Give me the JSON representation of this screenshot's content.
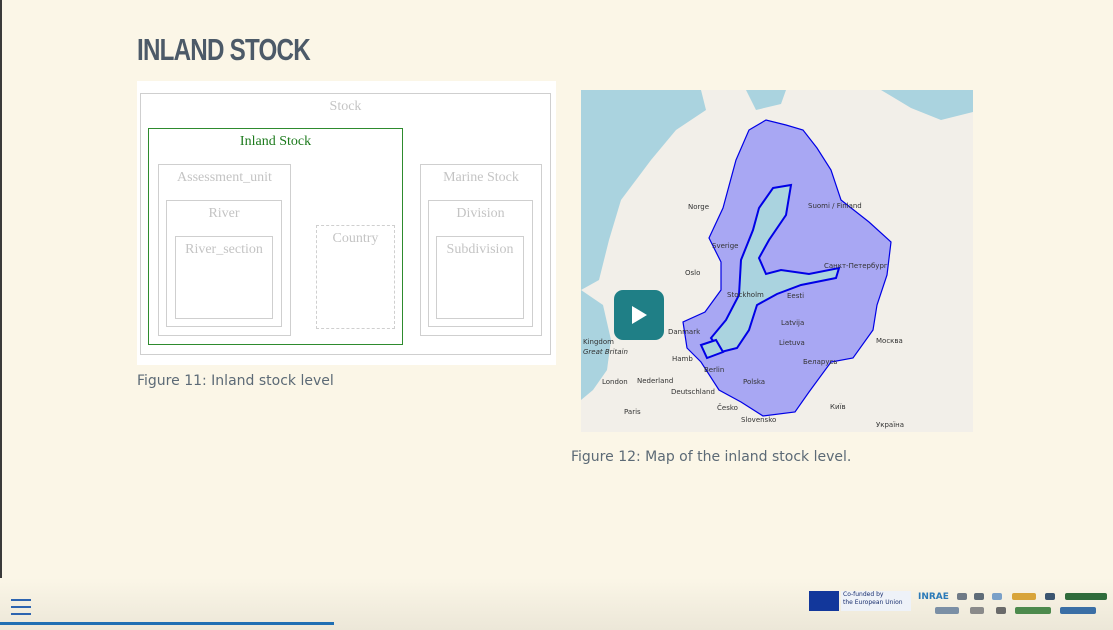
{
  "slide": {
    "title": "INLAND STOCK",
    "figure11_caption": "Figure 11: Inland stock level",
    "figure12_caption": "Figure 12: Map of the inland stock level."
  },
  "diagram": {
    "stock": "Stock",
    "inland_stock": "Inland Stock",
    "assessment_unit": "Assessment_unit",
    "river": "River",
    "river_section": "River_section",
    "country": "Country",
    "marine_stock": "Marine Stock",
    "division": "Division",
    "subdivision": "Subdivision"
  },
  "map": {
    "labels": {
      "finland": "Suomi / Finland",
      "norge": "Norge",
      "sverige": "Sverige",
      "oslo": "Oslo",
      "stockholm": "Stockholm",
      "eesti": "Eesti",
      "latvija": "Latvija",
      "lietuva": "Lietuva",
      "moskva": "Москва",
      "belarus": "Беларусь",
      "polska": "Polska",
      "kyiv": "Київ",
      "ukraina": "Україна",
      "cesko": "Česko",
      "slovensko": "Slovensko",
      "danmark": "Danmark",
      "deutschland": "Deutschland",
      "nederland": "Nederland",
      "london": "London",
      "paris": "Paris",
      "kingdom": "Kingdom",
      "great_britain": "Great Britain",
      "hamburg": "Hamb",
      "berlin": "Berlin",
      "spb": "Санкт-Петербург"
    },
    "colors": {
      "sea": "#aad3df",
      "land": "#f2efe9",
      "region_fill": "#8f8ff5",
      "region_stroke": "#0000e6"
    }
  },
  "player": {
    "play_icon": "play-icon",
    "menu_icon": "hamburger-menu-icon",
    "progress_percent": 30,
    "accent": "#1f7f86"
  },
  "footer": {
    "eu_line1": "Co-funded by",
    "eu_line2": "the European Union",
    "inrae": "INRAE"
  }
}
